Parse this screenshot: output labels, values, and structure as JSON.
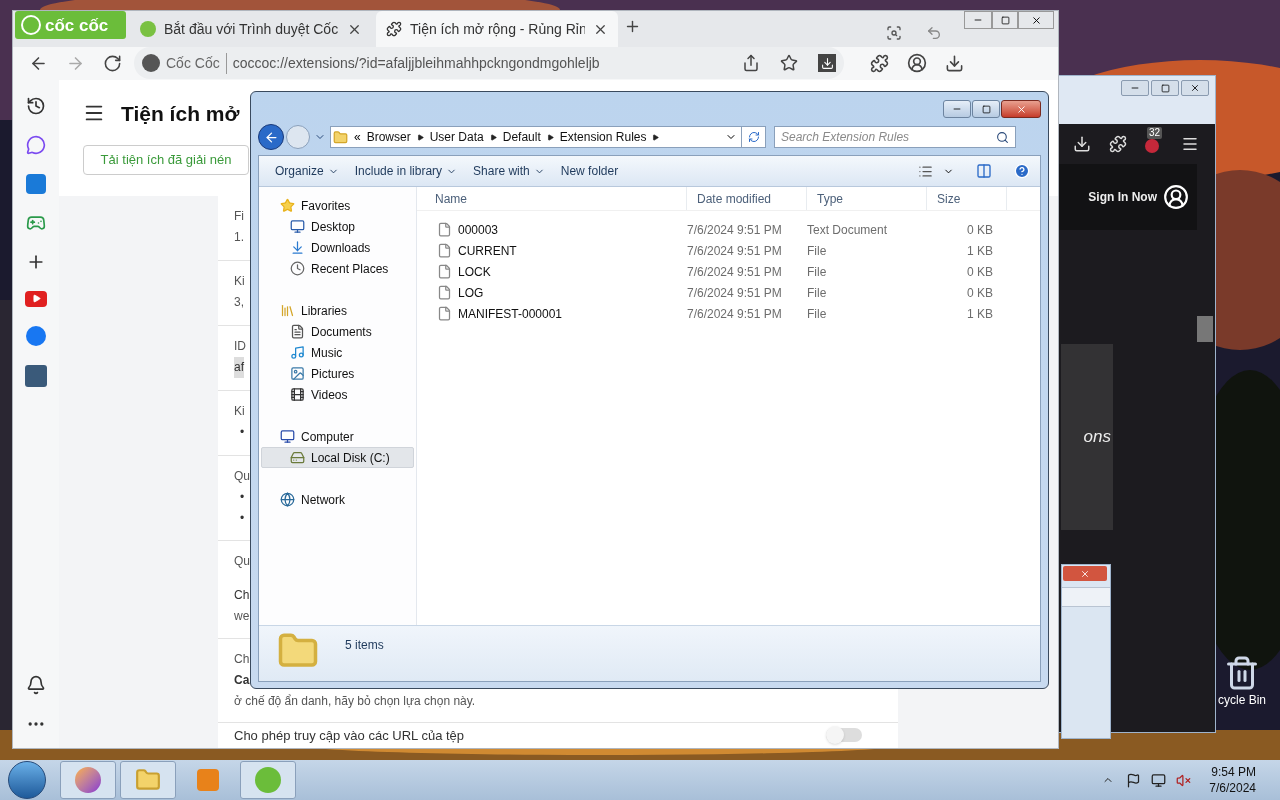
{
  "back_window": {
    "badge": "32",
    "sign_in": "Sign In Now",
    "panel_text": "ons"
  },
  "desktop": {
    "recycle_bin_label": "cycle Bin"
  },
  "browser": {
    "brand": "cốc cốc",
    "tabs": [
      {
        "title": "Bắt đầu với Trình duyệt Cốc",
        "selected": false
      },
      {
        "title": "Tiện ích mở rộng - Rủng Rỉn",
        "selected": true
      }
    ],
    "address": {
      "site_label": "Cốc Cốc",
      "url": "coccoc://extensions/?id=afaljjbleihmahhpckngondmgohleljb"
    },
    "page_title": "Tiện ích mở",
    "load_unpacked_button": "Tải tiện ích đã giải nén",
    "sections": [
      {
        "lines": [
          {
            "kind": "text",
            "text": "Fi"
          },
          {
            "kind": "text",
            "text": "1."
          }
        ]
      },
      {
        "lines": [
          {
            "kind": "text",
            "text": "Ki"
          },
          {
            "kind": "text",
            "text": "3,"
          }
        ]
      },
      {
        "lines": [
          {
            "kind": "text",
            "text": "ID"
          },
          {
            "kind": "highlight",
            "text": "af"
          }
        ]
      },
      {
        "lines": [
          {
            "kind": "text",
            "text": "Ki"
          },
          {
            "kind": "bullet",
            "text": "•"
          }
        ]
      },
      {
        "lines": [
          {
            "kind": "text",
            "text": "Qu"
          },
          {
            "kind": "bullet",
            "text": "•"
          },
          {
            "kind": "bullet",
            "text": "•"
          }
        ]
      },
      {
        "lines": [
          {
            "kind": "text",
            "text": "Qu"
          },
          {
            "kind": "gap",
            "text": "Ch"
          },
          {
            "kind": "text",
            "text": "we"
          }
        ]
      },
      {
        "lines": [
          {
            "kind": "text",
            "text": "Ch"
          },
          {
            "kind": "bold",
            "text": "Ca"
          },
          {
            "kind": "text",
            "text": "ở chế độ ẩn danh, hãy bỏ chọn lựa chọn này."
          }
        ]
      }
    ],
    "file_url_setting": {
      "label": "Cho phép truy cập vào các URL của tệp",
      "on": false
    }
  },
  "explorer": {
    "overflow_mark": "«",
    "breadcrumb": [
      "Browser",
      "User Data",
      "Default",
      "Extension Rules"
    ],
    "search_placeholder": "Search Extension Rules",
    "toolbar": [
      {
        "label": "Organize",
        "menu": true
      },
      {
        "label": "Include in library",
        "menu": true
      },
      {
        "label": "Share with",
        "menu": true
      },
      {
        "label": "New folder",
        "menu": false
      }
    ],
    "nav": [
      {
        "label": "Favorites",
        "kind": "star",
        "selected": false,
        "children": [
          {
            "label": "Desktop",
            "kind": "desktop",
            "selected": false
          },
          {
            "label": "Downloads",
            "kind": "downloads",
            "selected": false
          },
          {
            "label": "Recent Places",
            "kind": "recent",
            "selected": false
          }
        ]
      },
      {
        "label": "Libraries",
        "kind": "libraries",
        "selected": false,
        "children": [
          {
            "label": "Documents",
            "kind": "documents",
            "selected": false
          },
          {
            "label": "Music",
            "kind": "music",
            "selected": false
          },
          {
            "label": "Pictures",
            "kind": "pictures",
            "selected": false
          },
          {
            "label": "Videos",
            "kind": "videos",
            "selected": false
          }
        ]
      },
      {
        "label": "Computer",
        "kind": "computer",
        "selected": false,
        "children": [
          {
            "label": "Local Disk (C:)",
            "kind": "disk",
            "selected": true
          }
        ]
      },
      {
        "label": "Network",
        "kind": "network",
        "selected": false
      }
    ],
    "columns": [
      "Name",
      "Date modified",
      "Type",
      "Size"
    ],
    "files": [
      {
        "name": "000003",
        "date": "7/6/2024 9:51 PM",
        "type": "Text Document",
        "size": "0 KB"
      },
      {
        "name": "CURRENT",
        "date": "7/6/2024 9:51 PM",
        "type": "File",
        "size": "1 KB"
      },
      {
        "name": "LOCK",
        "date": "7/6/2024 9:51 PM",
        "type": "File",
        "size": "0 KB"
      },
      {
        "name": "LOG",
        "date": "7/6/2024 9:51 PM",
        "type": "File",
        "size": "0 KB"
      },
      {
        "name": "MANIFEST-000001",
        "date": "7/6/2024 9:51 PM",
        "type": "File",
        "size": "1 KB"
      }
    ],
    "status": "5 items"
  },
  "taskbar": {
    "time": "9:54 PM",
    "date": "7/6/2024"
  }
}
